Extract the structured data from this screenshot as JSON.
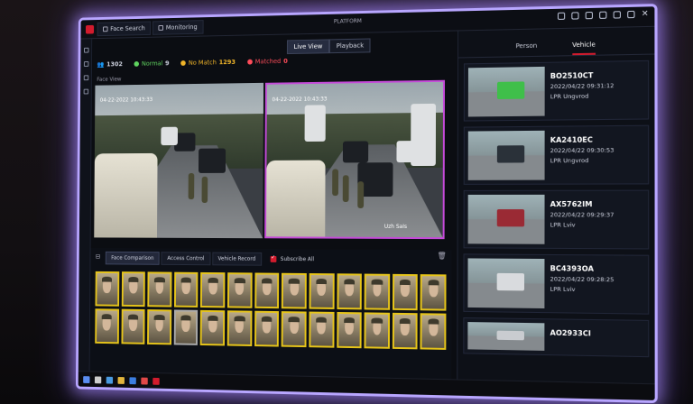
{
  "window": {
    "title": "PLATFORM"
  },
  "tabs": [
    {
      "label": "Face Search"
    },
    {
      "label": "Monitoring"
    }
  ],
  "view_switch": {
    "live": "Live View",
    "playback": "Playback"
  },
  "stats": {
    "total": "1302",
    "normal_label": "Normal",
    "normal_value": "9",
    "nomatch_label": "No Match",
    "nomatch_value": "1293",
    "matched_label": "Matched",
    "matched_value": "0"
  },
  "left_label": "Face View",
  "cameras": [
    {
      "timestamp": "04-22-2022 10:43:33"
    },
    {
      "timestamp": "04-22-2022 10:43:33",
      "watermark": "Uzh SaIs"
    }
  ],
  "bottom_tabs": [
    "Face Comparison",
    "Access Control",
    "Vehicle Record"
  ],
  "subscribe": {
    "label": "Subscribe All"
  },
  "right_tabs": [
    "Person",
    "Vehicle"
  ],
  "vehicles": [
    {
      "plate": "BO2510CT",
      "time": "2022/04/22 09:31:12",
      "source": "LPR Ungvrod"
    },
    {
      "plate": "KA2410EC",
      "time": "2022/04/22 09:30:53",
      "source": "LPR Ungvrod"
    },
    {
      "plate": "AX5762IM",
      "time": "2022/04/22 09:29:37",
      "source": "LPR Lviv"
    },
    {
      "plate": "BC4393OA",
      "time": "2022/04/22 09:28:25",
      "source": "LPR Lviv"
    },
    {
      "plate": "AO2933CI",
      "time": "",
      "source": ""
    }
  ],
  "colors": {
    "accent": "#d21b2d",
    "frame_glow": "#b8a6ff",
    "thumb_border": "#e6c419",
    "selection": "#c44ad8"
  }
}
